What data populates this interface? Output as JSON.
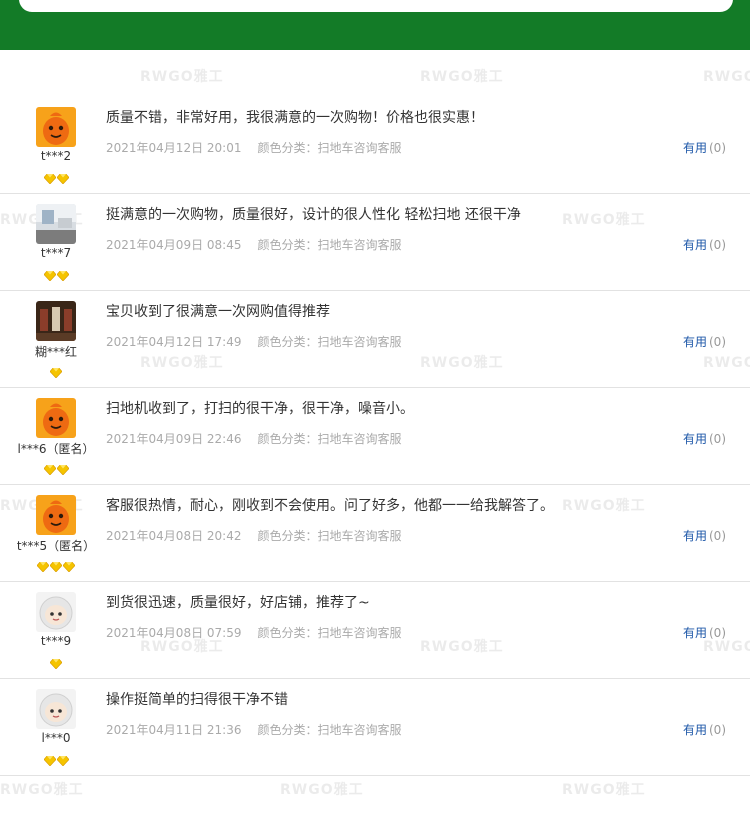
{
  "watermark_text": "RWGO雅工",
  "helpful_label": "有用",
  "reviews": [
    {
      "user": "t***2",
      "gems": 2,
      "avatar": "orange-mascot-avatar",
      "text": "质量不错，非常好用，我很满意的一次购物！价格也很实惠！",
      "date": "2021年04月12日 20:01",
      "variant": "颜色分类：扫地车咨询客服",
      "helpful_count": "(0)"
    },
    {
      "user": "t***7",
      "gems": 2,
      "avatar": "room-photo-avatar",
      "text": "挺满意的一次购物，质量很好，设计的很人性化 轻松扫地 还很干净",
      "date": "2021年04月09日 08:45",
      "variant": "颜色分类：扫地车咨询客服",
      "helpful_count": "(0)"
    },
    {
      "user": "糊***红",
      "gems": 1,
      "avatar": "interior-photo-avatar",
      "text": "宝贝收到了很满意一次网购值得推荐",
      "date": "2021年04月12日 17:49",
      "variant": "颜色分类：扫地车咨询客服",
      "helpful_count": "(0)"
    },
    {
      "user": "l***6（匿名）",
      "gems": 2,
      "avatar": "orange-mascot-avatar",
      "text": "扫地机收到了，打扫的很干净，很干净，噪音小。",
      "date": "2021年04月09日 22:46",
      "variant": "颜色分类：扫地车咨询客服",
      "helpful_count": "(0)"
    },
    {
      "user": "t***5（匿名）",
      "gems": 3,
      "avatar": "orange-mascot-avatar",
      "text": "客服很热情，耐心，刚收到不会使用。问了好多，他都一一给我解答了。",
      "date": "2021年04月08日 20:42",
      "variant": "颜色分类：扫地车咨询客服",
      "helpful_count": "(0)"
    },
    {
      "user": "t***9",
      "gems": 1,
      "avatar": "white-mascot-avatar",
      "text": "到货很迅速，质量很好，好店铺，推荐了~",
      "date": "2021年04月08日 07:59",
      "variant": "颜色分类：扫地车咨询客服",
      "helpful_count": "(0)"
    },
    {
      "user": "l***0",
      "gems": 2,
      "avatar": "white-mascot-avatar",
      "text": "操作挺简单的扫得很干净不错",
      "date": "2021年04月11日 21:36",
      "variant": "颜色分类：扫地车咨询客服",
      "helpful_count": "(0)"
    }
  ]
}
